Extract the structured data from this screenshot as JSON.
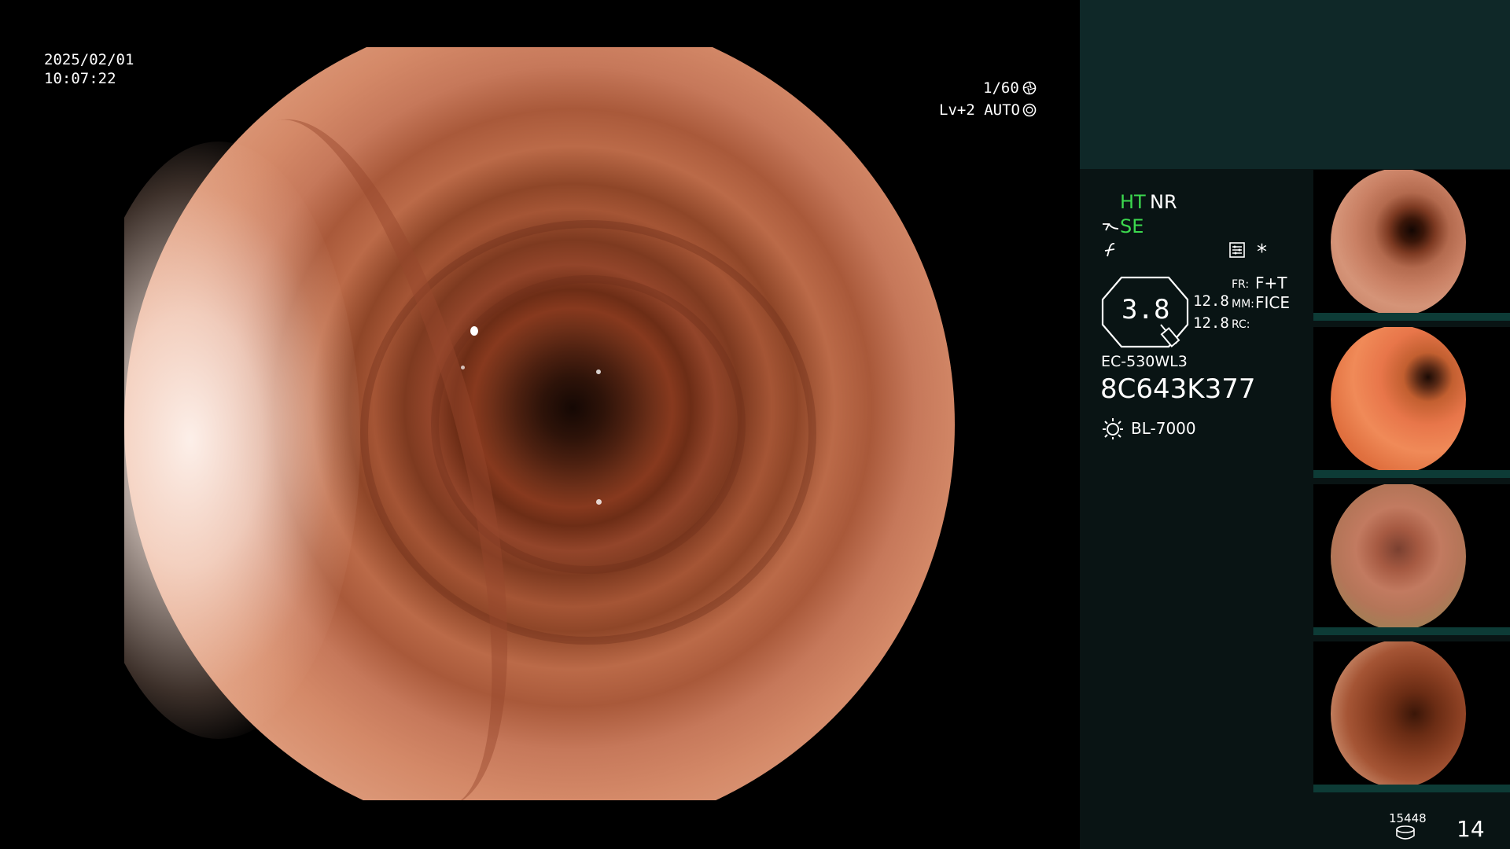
{
  "main_view": {
    "date": "2025/02/01",
    "time": "10:07:22",
    "shutter": "1/60",
    "iris_mode": "Lv+2 AUTO"
  },
  "hud": {
    "ht": "HT",
    "nr": "NR",
    "se": "SE",
    "zoom_value": "3.8",
    "val_top": "12.8",
    "val_bottom": "12.8",
    "fr_label": "FR:",
    "fr_value": "F+T",
    "mm_label": "MM:",
    "mm_value": "FICE",
    "rc_label": "RC:",
    "scope_model": "EC-530WL3",
    "scope_serial": "8C643K377",
    "light_source": "BL-7000",
    "accent_green": "#3cd84e"
  },
  "footer": {
    "storage_count": "15448",
    "image_count": "14"
  },
  "thumbnails": [
    {
      "label": "thumbnail-1"
    },
    {
      "label": "thumbnail-2"
    },
    {
      "label": "thumbnail-3"
    },
    {
      "label": "thumbnail-4"
    }
  ]
}
